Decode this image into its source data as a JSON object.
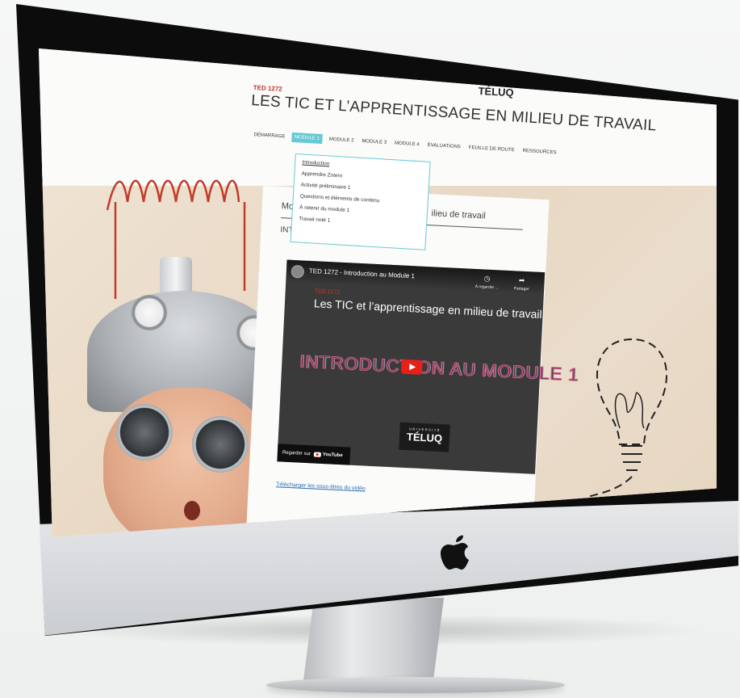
{
  "header": {
    "course_code": "TED 1272",
    "course_title": "LES TIC ET L’APPRENTISSAGE EN MILIEU DE TRAVAIL",
    "brand": "TÉLUQ"
  },
  "nav": {
    "items": [
      {
        "label": "DÉMARRAGE"
      },
      {
        "label": "MODULE 1"
      },
      {
        "label": "MODULE 2"
      },
      {
        "label": "MODULE 3"
      },
      {
        "label": "MODULE 4"
      },
      {
        "label": "ÉVALUATIONS"
      },
      {
        "label": "FEUILLE DE ROUTE"
      },
      {
        "label": "RESSOURCES"
      }
    ],
    "active_index": 1
  },
  "dropdown": {
    "items": [
      {
        "label": "Introduction"
      },
      {
        "label": "Apprendre Zotero"
      },
      {
        "label": "Activité préliminaire 1"
      },
      {
        "label": "Questions et éléments de contenu"
      },
      {
        "label": "À retenir du module 1"
      },
      {
        "label": "Travail noté 1"
      }
    ]
  },
  "content": {
    "title_left": "Mo",
    "title_right": "ilieu de travail",
    "intro_label": "INTR"
  },
  "video": {
    "title": "TED 1272 - Introduction au Module 1",
    "watch_later": "À regarder ...",
    "share": "Partager",
    "small_label": "TED 1272",
    "heading": "Les TIC et l’apprentissage en milieu de travail",
    "banner": "INTRODUCTION AU MODULE 1",
    "uni_label": "UNIVERSITÉ",
    "uni_name": "TÉLUQ",
    "watch_on": "Regarder sur",
    "yt_label": "YouTube"
  },
  "links": {
    "download": "Télécharger les sous-titres du vidéo"
  },
  "colors": {
    "accent": "#66c9d4",
    "brand_red": "#c0392b",
    "youtube_red": "#e62117"
  }
}
